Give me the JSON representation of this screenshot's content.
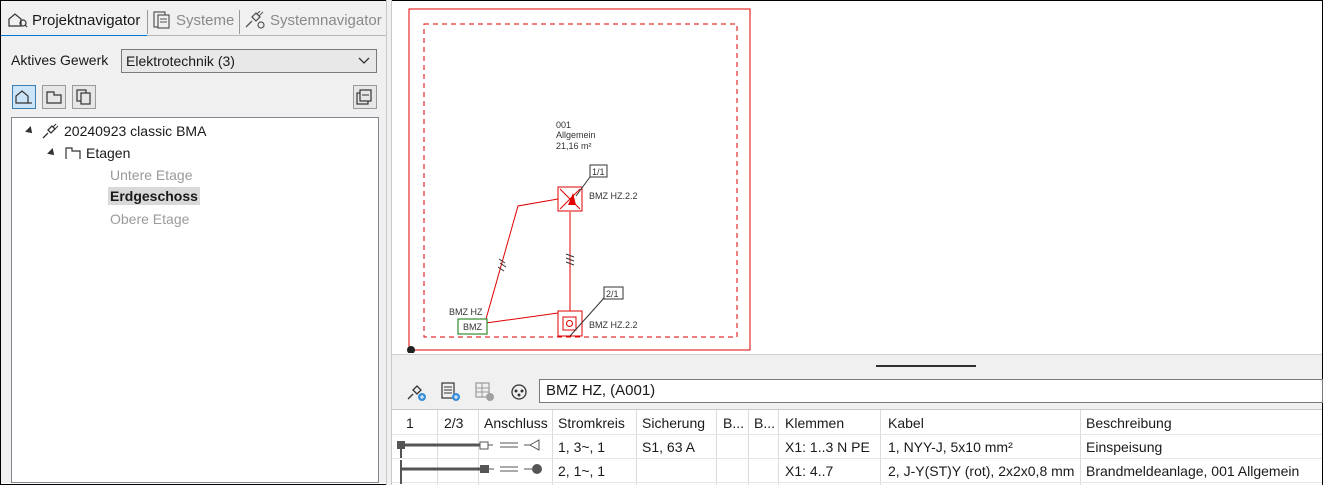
{
  "tabs": [
    {
      "label": "Projektnavigator",
      "icon": "project-navigator-icon",
      "active": true
    },
    {
      "label": "Systeme",
      "icon": "systems-icon",
      "active": false
    },
    {
      "label": "Systemnavigator",
      "icon": "system-navigator-icon",
      "active": false
    }
  ],
  "gewerk": {
    "label": "Aktives Gewerk",
    "value": "Elektrotechnik (3)"
  },
  "tree": {
    "project": "20240923 classic BMA",
    "etagen_label": "Etagen",
    "etagen": [
      "Untere Etage",
      "Erdgeschoss",
      "Obere Etage"
    ],
    "selected": "Erdgeschoss"
  },
  "drawing": {
    "room_number": "001",
    "room_name": "Allgemein",
    "room_area": "21,16 m²",
    "tag1": "1/1",
    "tag2": "2/1",
    "device1": "BMZ HZ.2.2",
    "device2": "BMZ HZ.2.2",
    "bmz_label": "BMZ HZ",
    "bmz_box": "BMZ",
    "line_color": "#e00000",
    "bmz_color": "#2e8b2e"
  },
  "lower": {
    "title": "BMZ HZ,  (A001)",
    "columns": [
      "1",
      "2/3",
      "Anschluss",
      "Stromkreis",
      "Sicherung",
      "B...",
      "B...",
      "Klemmen",
      "Kabel",
      "Beschreibung"
    ],
    "rows": [
      {
        "stromkreis": "1, 3~, 1",
        "sicherung": "S1, 63 A",
        "klemmen": "X1: 1..3 N PE",
        "kabel": "1, NYY-J, 5x10 mm²",
        "beschreibung": "Einspeisung"
      },
      {
        "stromkreis": "2, 1~, 1",
        "sicherung": "",
        "klemmen": "X1: 4..7",
        "kabel": "2, J-Y(ST)Y (rot), 2x2x0,8 mm",
        "beschreibung": "Brandmeldeanlage, 001 Allgemein"
      }
    ]
  }
}
